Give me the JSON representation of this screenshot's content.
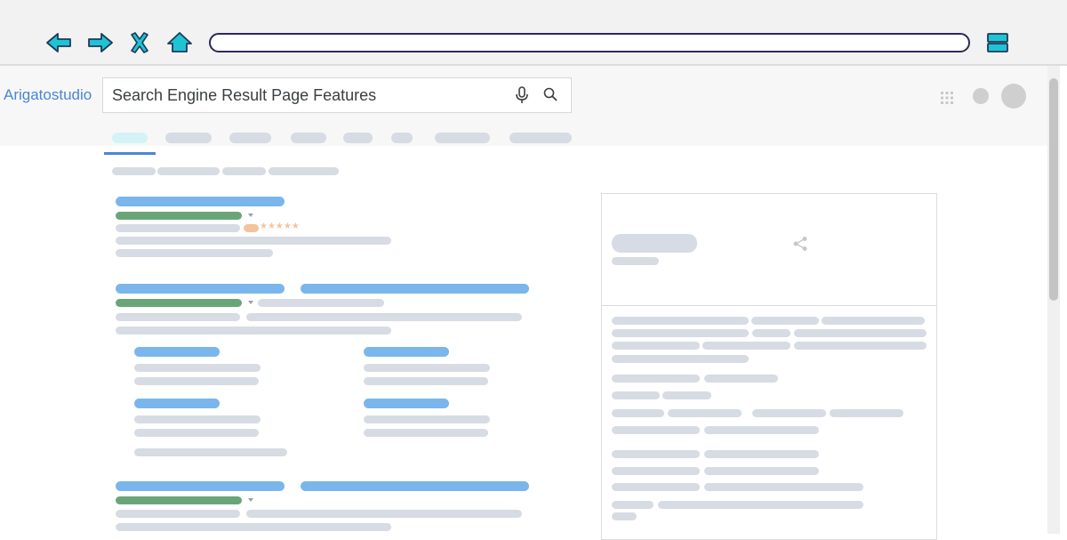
{
  "browser": {
    "nav_icons": [
      "back-arrow-icon",
      "forward-arrow-icon",
      "close-icon",
      "home-icon"
    ],
    "address_value": "",
    "menu_icon": "hamburger-menu-icon"
  },
  "header": {
    "logo_text": "Arigatostudio",
    "search": {
      "value": "Search Engine Result Page Features",
      "icons": [
        "microphone-icon",
        "search-icon"
      ]
    },
    "right_icons": [
      "apps-grid-icon",
      "notifications-dot",
      "avatar"
    ]
  },
  "result": {
    "rating_stars": "★★★★★"
  },
  "colors": {
    "nav_icon_fill": "#1ec4d4",
    "nav_icon_stroke": "#1d3a5a",
    "logo": "#4a86d6",
    "link_placeholder": "#7ab6ec",
    "url_placeholder": "#6aa57a",
    "text_placeholder": "#d7dbe3",
    "rating": "#f3c39c",
    "active_tab": "#4a86d6"
  }
}
